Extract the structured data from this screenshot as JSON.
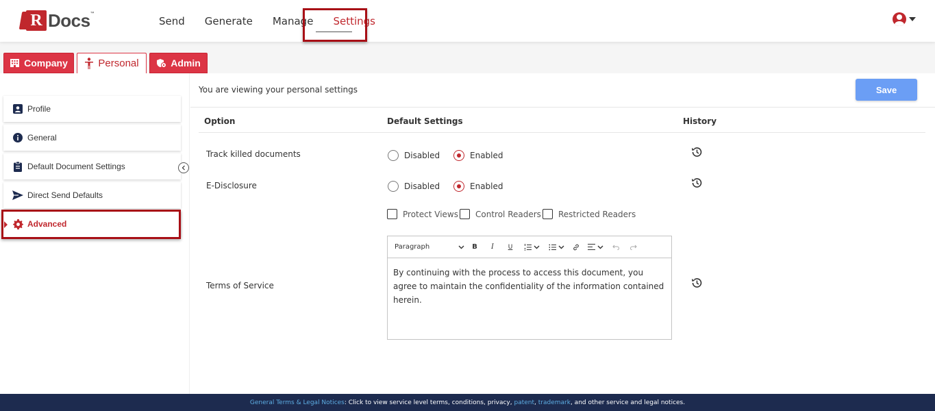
{
  "logo": {
    "text": "Docs",
    "mark": "R",
    "tm": "™"
  },
  "nav": {
    "items": [
      {
        "label": "Send"
      },
      {
        "label": "Generate"
      },
      {
        "label": "Manage"
      },
      {
        "label": "Settings",
        "active": true
      }
    ]
  },
  "tabs": {
    "company": "Company",
    "personal": "Personal",
    "admin": "Admin"
  },
  "sidebar": {
    "items": [
      {
        "label": "Profile",
        "icon": "profile-card-icon"
      },
      {
        "label": "General",
        "icon": "info-icon"
      },
      {
        "label": "Default Document Settings",
        "icon": "clipboard-icon"
      },
      {
        "label": "Direct Send Defaults",
        "icon": "paper-plane-icon"
      },
      {
        "label": "Advanced",
        "icon": "gear-icon",
        "active": true
      }
    ]
  },
  "main": {
    "title": "You are viewing your personal settings",
    "save_label": "Save",
    "columns": {
      "option": "Option",
      "default": "Default Settings",
      "history": "History"
    },
    "rows": [
      {
        "label": "Track killed documents",
        "disabled": "Disabled",
        "enabled": "Enabled",
        "selected": "Enabled"
      },
      {
        "label": "E-Disclosure",
        "disabled": "Disabled",
        "enabled": "Enabled",
        "selected": "Enabled"
      }
    ],
    "checkboxes": [
      {
        "label": "Protect Views",
        "checked": false
      },
      {
        "label": "Control Readers",
        "checked": false
      },
      {
        "label": "Restricted Readers",
        "checked": false
      }
    ],
    "terms": {
      "label": "Terms of Service",
      "paragraph_style": "Paragraph",
      "content": "By continuing with the process to access this document, you agree to maintain the confidentiality of the information contained herein."
    }
  },
  "footer": {
    "link1": "General Terms & Legal Notices",
    "text1": ": Click to view service level terms, conditions, privacy, ",
    "link2": "patent",
    "sep": ", ",
    "link3": "trademark",
    "text2": ", and other service and legal notices."
  },
  "colors": {
    "brand_red": "#c0272d",
    "tab_red": "#dc3545",
    "save_blue": "#6b9ef5",
    "footer_navy": "#1d2b4f"
  }
}
